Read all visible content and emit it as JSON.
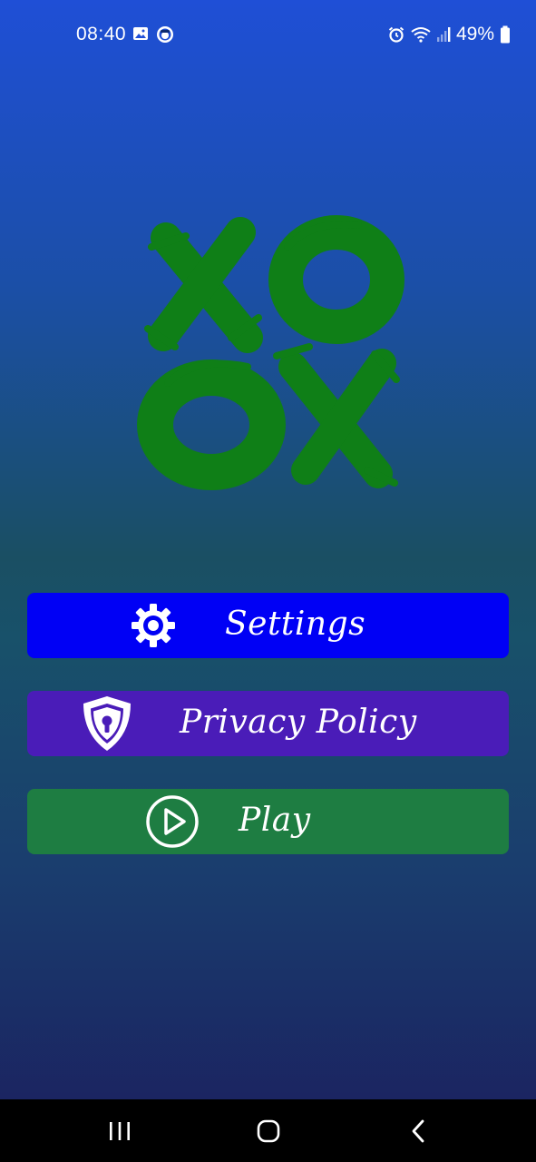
{
  "status_bar": {
    "time": "08:40",
    "battery_percent": "49%",
    "left_icons": [
      "gallery-icon",
      "avatar-icon"
    ],
    "right_icons": [
      "alarm-icon",
      "wifi-icon",
      "signal-icon",
      "battery-icon"
    ]
  },
  "logo": {
    "color": "#0f7f17",
    "grid": [
      [
        "X",
        "O"
      ],
      [
        "O",
        "X"
      ]
    ]
  },
  "menu": {
    "settings_label": "Settings",
    "privacy_label": "Privacy Policy",
    "play_label": "Play"
  },
  "colors": {
    "settings_button": "#0000f5",
    "privacy_button": "#4a1cb8",
    "play_button": "#1e7d42",
    "logo_green": "#0f7f17"
  },
  "nav_bar": {
    "icons": [
      "recent-apps-icon",
      "home-icon",
      "back-icon"
    ]
  }
}
